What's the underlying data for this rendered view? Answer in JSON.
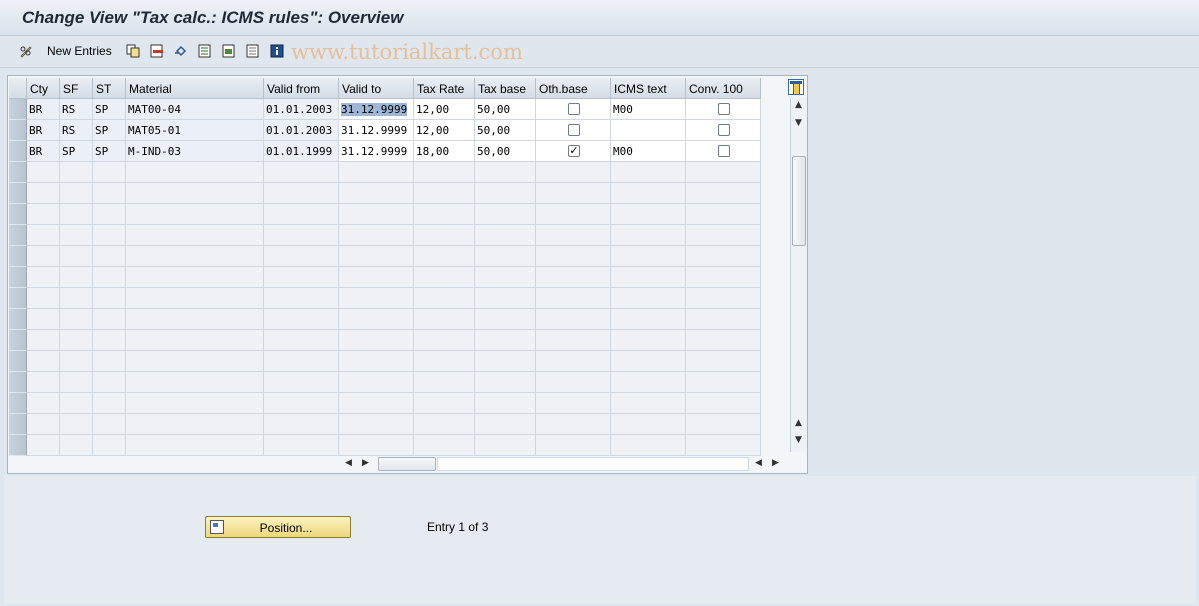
{
  "title": "Change View \"Tax calc.: ICMS rules\": Overview",
  "toolbar": {
    "new_entries": "New Entries",
    "icons": [
      "pencil-glasses-icon",
      "copy-icon",
      "delete-icon",
      "undo-icon",
      "select-all-icon",
      "select-block-icon",
      "deselect-all-icon",
      "info-icon"
    ],
    "watermark": "www.tutorialkart.com"
  },
  "table": {
    "headers": [
      "Cty",
      "SF",
      "ST",
      "Material",
      "Valid from",
      "Valid to",
      "Tax Rate",
      "Tax base",
      "Oth.base",
      "ICMS text",
      "Conv. 100"
    ],
    "rows": [
      {
        "cty": "BR",
        "sf": "RS",
        "st": "SP",
        "material": "MAT00-04",
        "valid_from": "01.01.2003",
        "valid_to": "31.12.9999",
        "tax_rate": "12,00",
        "tax_base": "50,00",
        "oth_base": false,
        "icms_text": "M00",
        "conv100": false
      },
      {
        "cty": "BR",
        "sf": "RS",
        "st": "SP",
        "material": "MAT05-01",
        "valid_from": "01.01.2003",
        "valid_to": "31.12.9999",
        "tax_rate": "12,00",
        "tax_base": "50,00",
        "oth_base": false,
        "icms_text": "",
        "conv100": false
      },
      {
        "cty": "BR",
        "sf": "SP",
        "st": "SP",
        "material": "M-IND-03",
        "valid_from": "01.01.1999",
        "valid_to": "31.12.9999",
        "tax_rate": "18,00",
        "tax_base": "50,00",
        "oth_base": true,
        "icms_text": "M00",
        "conv100": false
      }
    ],
    "empty_rows": 14,
    "highlighted_cell": "valid_to"
  },
  "footer": {
    "position_button": "Position...",
    "entry_text": "Entry 1 of 3"
  },
  "colors": {
    "accent": "#9db7d4",
    "button": "#eed77a"
  }
}
